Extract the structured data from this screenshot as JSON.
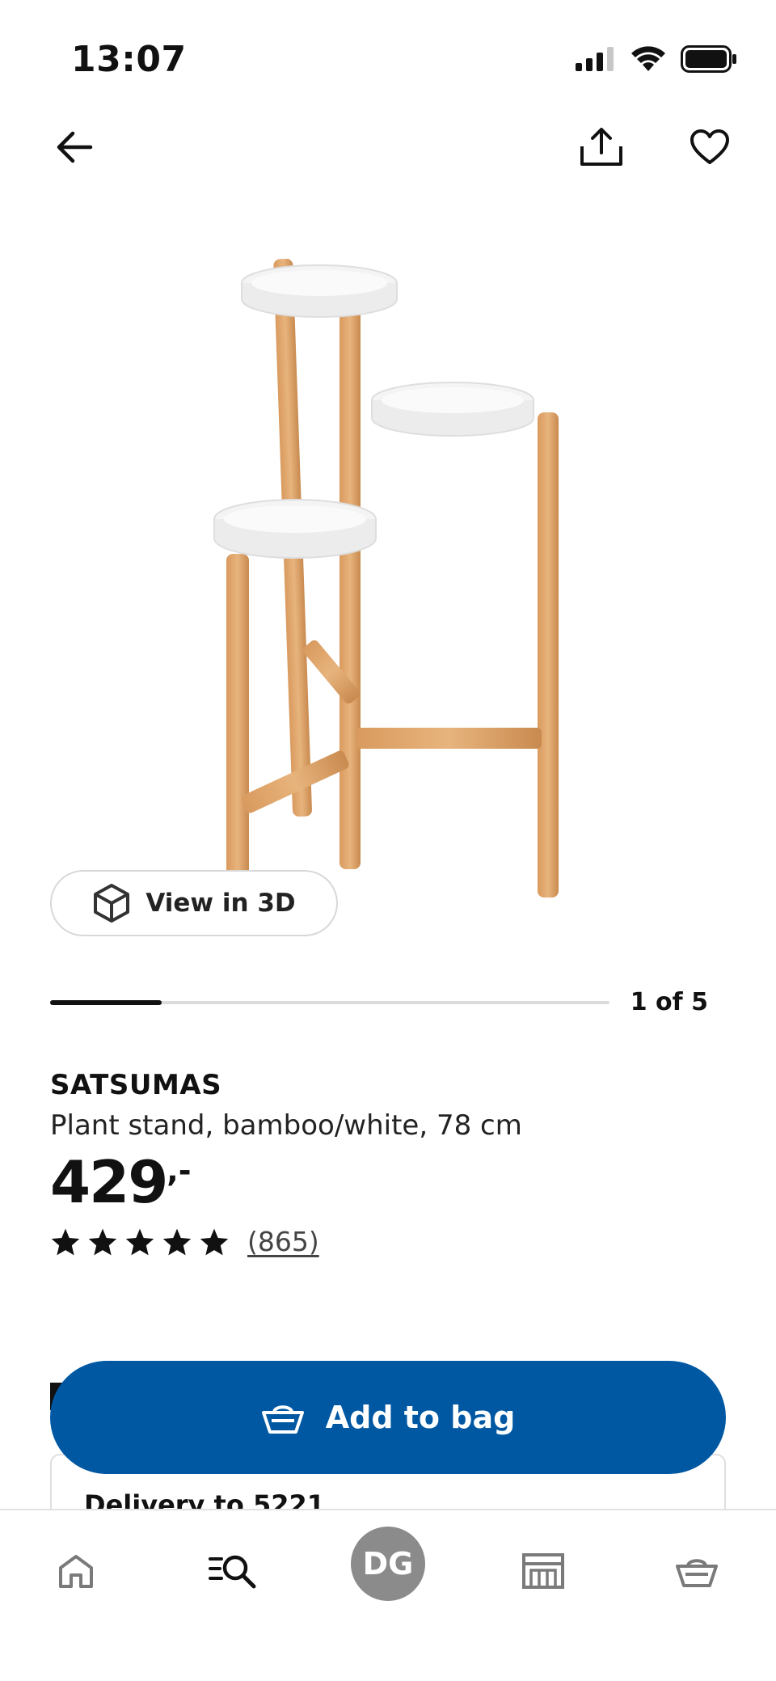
{
  "status_bar": {
    "time": "13:07"
  },
  "icons": {
    "back": "arrow-left-icon",
    "share": "share-icon",
    "favorite": "heart-icon",
    "cube": "cube-icon",
    "bag": "basket-icon",
    "home": "home-icon",
    "search": "search-icon",
    "store": "store-icon",
    "basket": "basket-icon"
  },
  "image": {
    "alt": "SATSUMAS plant stand"
  },
  "view3d": {
    "label": "View in 3D"
  },
  "carousel": {
    "current": 1,
    "total": 5,
    "label": "1 of 5",
    "progress": 0.2
  },
  "product": {
    "name": "SATSUMAS",
    "description": "Plant stand, bamboo/white, 78 cm",
    "price": "429",
    "price_suffix": ",-",
    "rating": 5,
    "review_count": "(865)"
  },
  "delivery": {
    "label": "Delivery to 5221"
  },
  "actions": {
    "add_to_bag": "Add to bag"
  },
  "bottom_nav": {
    "avatar_initials": "DG"
  },
  "colors": {
    "brand_blue": "#0058a3",
    "avatar_gray": "#8b8b8b"
  }
}
